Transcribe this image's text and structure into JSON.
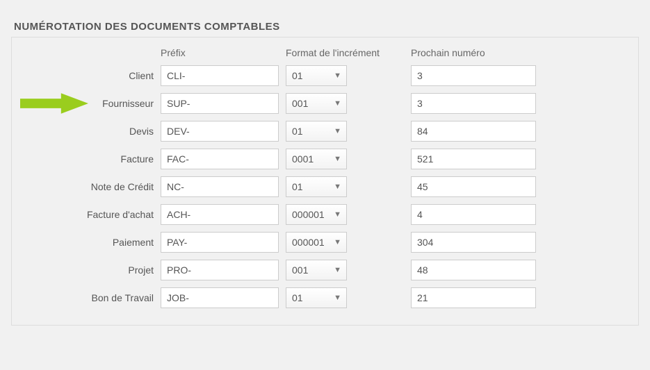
{
  "title": "NUMÉROTATION DES DOCUMENTS COMPTABLES",
  "headers": {
    "prefix": "Préfix",
    "format": "Format de l'incrément",
    "next": "Prochain numéro"
  },
  "rows": [
    {
      "key": "client",
      "label": "Client",
      "prefix": "CLI-",
      "format": "01",
      "next": "3",
      "highlight": false
    },
    {
      "key": "fournisseur",
      "label": "Fournisseur",
      "prefix": "SUP-",
      "format": "001",
      "next": "3",
      "highlight": true
    },
    {
      "key": "devis",
      "label": "Devis",
      "prefix": "DEV-",
      "format": "01",
      "next": "84",
      "highlight": false
    },
    {
      "key": "facture",
      "label": "Facture",
      "prefix": "FAC-",
      "format": "0001",
      "next": "521",
      "highlight": false
    },
    {
      "key": "note-credit",
      "label": "Note de Crédit",
      "prefix": "NC-",
      "format": "01",
      "next": "45",
      "highlight": false
    },
    {
      "key": "facture-achat",
      "label": "Facture d'achat",
      "prefix": "ACH-",
      "format": "000001",
      "next": "4",
      "highlight": false
    },
    {
      "key": "paiement",
      "label": "Paiement",
      "prefix": "PAY-",
      "format": "000001",
      "next": "304",
      "highlight": false
    },
    {
      "key": "projet",
      "label": "Projet",
      "prefix": "PRO-",
      "format": "001",
      "next": "48",
      "highlight": false
    },
    {
      "key": "bon-travail",
      "label": "Bon de Travail",
      "prefix": "JOB-",
      "format": "01",
      "next": "21",
      "highlight": false
    }
  ],
  "colors": {
    "arrow": "#9acd1e"
  }
}
